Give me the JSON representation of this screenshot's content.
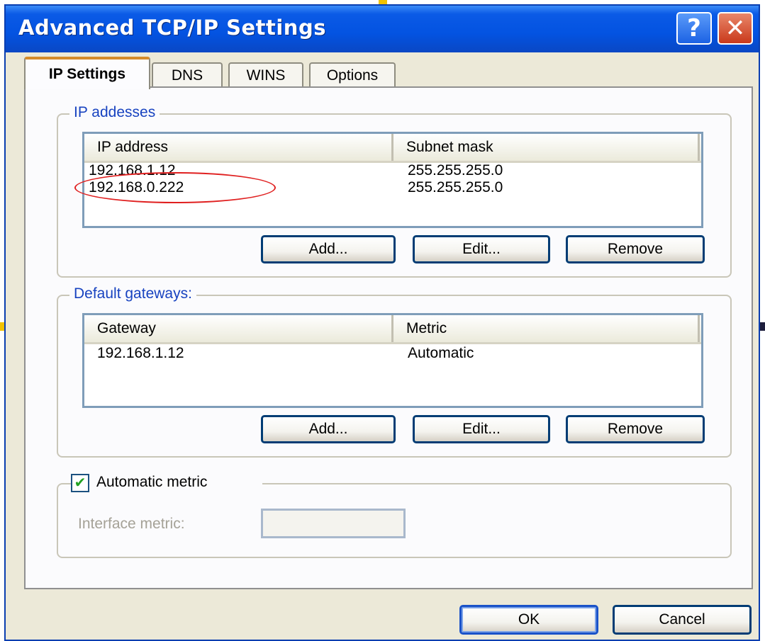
{
  "window": {
    "title": "Advanced TCP/IP Settings",
    "help_label": "?",
    "close_label": "✕",
    "accent_color": "#0a53e1",
    "close_color": "#d4431f"
  },
  "tabs": [
    {
      "label": "IP Settings",
      "active": true
    },
    {
      "label": "DNS",
      "active": false
    },
    {
      "label": "WINS",
      "active": false
    },
    {
      "label": "Options",
      "active": false
    }
  ],
  "ip_addresses": {
    "legend": "IP addesses",
    "columns": [
      "IP address",
      "Subnet mask"
    ],
    "rows": [
      {
        "ip": "192.168.1.12",
        "mask": "255.255.255.0"
      },
      {
        "ip": "192.168.0.222",
        "mask": "255.255.255.0"
      }
    ],
    "buttons": {
      "add": "Add...",
      "edit": "Edit...",
      "remove": "Remove"
    }
  },
  "gateways": {
    "legend": "Default gateways:",
    "columns": [
      "Gateway",
      "Metric"
    ],
    "rows": [
      {
        "gateway": "192.168.1.12",
        "metric": "Automatic"
      }
    ],
    "buttons": {
      "add": "Add...",
      "edit": "Edit...",
      "remove": "Remove"
    }
  },
  "metric": {
    "checkbox_label": "Automatic metric",
    "checked": true,
    "interface_label": "Interface metric:",
    "interface_value": ""
  },
  "footer": {
    "ok": "OK",
    "cancel": "Cancel"
  }
}
